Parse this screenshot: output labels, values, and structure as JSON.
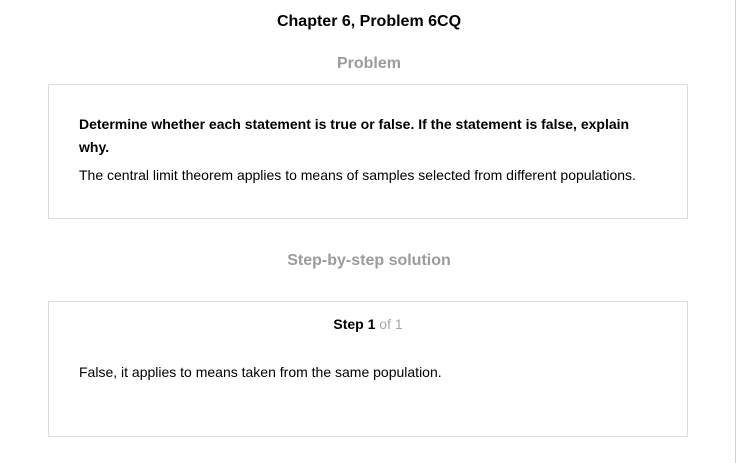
{
  "header": {
    "chapter_title": "Chapter 6, Problem 6CQ"
  },
  "problem": {
    "heading": "Problem",
    "instruction": "Determine whether each statement is true or false. If the statement is false, explain why.",
    "statement": "The central limit theorem applies to means of samples selected from different populations."
  },
  "solution": {
    "heading": "Step-by-step solution",
    "step_word": "Step",
    "step_current": "1",
    "step_of": "of 1",
    "answer": "False, it applies to means taken from the same population."
  }
}
